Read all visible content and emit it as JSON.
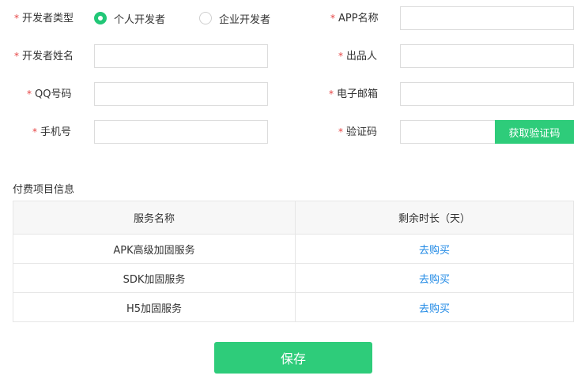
{
  "form": {
    "developer_type": {
      "label": "开发者类型",
      "options": [
        {
          "label": "个人开发者",
          "checked": true
        },
        {
          "label": "企业开发者",
          "checked": false
        }
      ]
    },
    "app_name": {
      "label": "APP名称",
      "value": ""
    },
    "developer_name": {
      "label": "开发者姓名",
      "value": ""
    },
    "publisher": {
      "label": "出品人",
      "value": ""
    },
    "qq": {
      "label": "QQ号码",
      "value": ""
    },
    "email": {
      "label": "电子邮箱",
      "value": ""
    },
    "phone": {
      "label": "手机号",
      "value": ""
    },
    "captcha": {
      "label": "验证码",
      "value": "",
      "button": "获取验证码"
    },
    "required_mark": "*"
  },
  "paid_items": {
    "title": "付费项目信息",
    "headers": [
      "服务名称",
      "剩余时长（天）"
    ],
    "rows": [
      {
        "name": "APK高级加固服务",
        "action": "去购买"
      },
      {
        "name": "SDK加固服务",
        "action": "去购买"
      },
      {
        "name": "H5加固服务",
        "action": "去购买"
      }
    ]
  },
  "save_label": "保存",
  "colors": {
    "accent": "#2ecc7a",
    "required": "#e64343",
    "link": "#1e88e5"
  }
}
